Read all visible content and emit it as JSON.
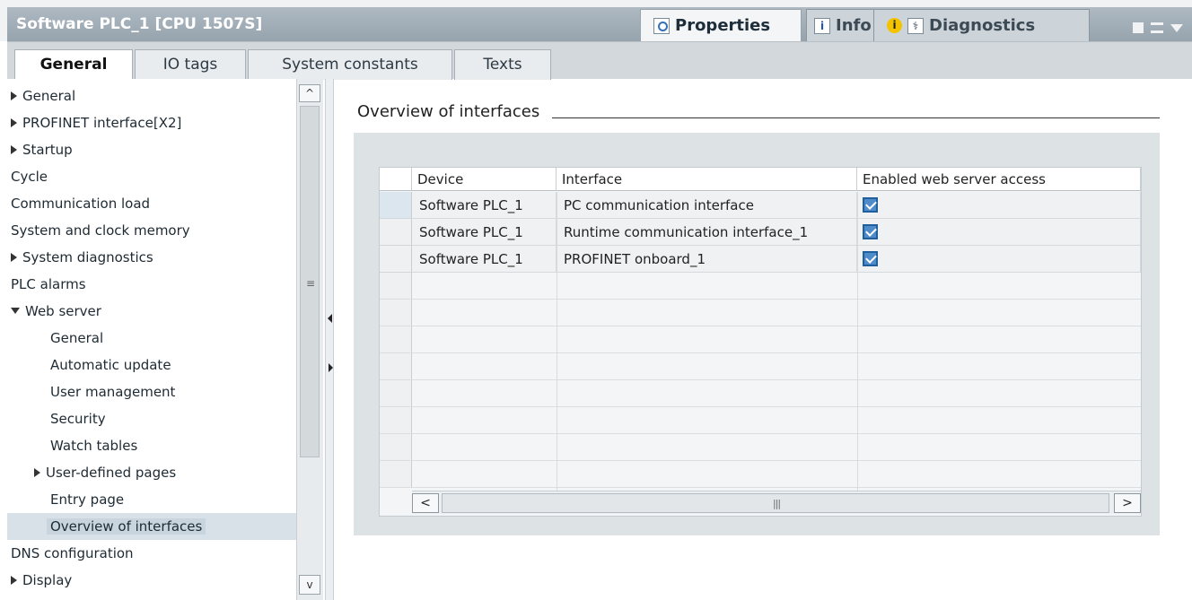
{
  "window": {
    "title": "Software PLC_1 [CPU 1507S]",
    "tabs": {
      "properties": "Properties",
      "info": "Info",
      "diagnostics": "Diagnostics"
    }
  },
  "section_tabs": [
    "General",
    "IO tags",
    "System constants",
    "Texts"
  ],
  "tree": {
    "items": [
      {
        "label": "General",
        "arrow": "right"
      },
      {
        "label": "PROFINET interface[X2]",
        "arrow": "right"
      },
      {
        "label": "Startup",
        "arrow": "right"
      },
      {
        "label": "Cycle"
      },
      {
        "label": "Communication load"
      },
      {
        "label": "System and clock memory"
      },
      {
        "label": "System diagnostics",
        "arrow": "right"
      },
      {
        "label": "PLC alarms"
      },
      {
        "label": "Web server",
        "arrow": "down"
      },
      {
        "label": "General"
      },
      {
        "label": "Automatic update"
      },
      {
        "label": "User management"
      },
      {
        "label": "Security"
      },
      {
        "label": "Watch tables"
      },
      {
        "label": "User-defined pages",
        "arrow": "right"
      },
      {
        "label": "Entry page"
      },
      {
        "label": "Overview of interfaces",
        "selected": true
      },
      {
        "label": "DNS configuration"
      },
      {
        "label": "Display",
        "arrow": "right"
      }
    ]
  },
  "content": {
    "section_title": "Overview of interfaces",
    "table": {
      "headers": [
        "Device",
        "Interface",
        "Enabled web server access"
      ],
      "rows": [
        {
          "device": "Software PLC_1",
          "interface": "PC communication interface",
          "enabled": true
        },
        {
          "device": "Software PLC_1",
          "interface": "Runtime communication interface_1",
          "enabled": true
        },
        {
          "device": "Software PLC_1",
          "interface": "PROFINET onboard_1",
          "enabled": true
        }
      ]
    }
  }
}
